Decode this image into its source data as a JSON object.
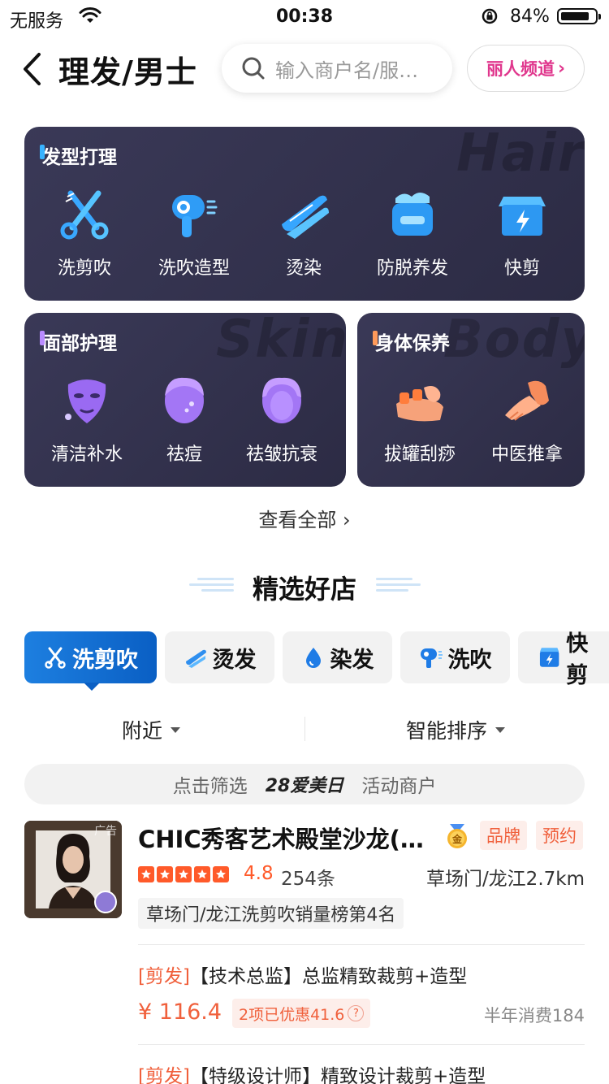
{
  "status_bar": {
    "carrier": "无服务",
    "time": "00:38",
    "battery": "84%"
  },
  "header": {
    "title": "理发/男士",
    "search_placeholder": "输入商户名/服务名",
    "channel_label": "丽人频道"
  },
  "categories": {
    "hair": {
      "title": "发型打理",
      "bg_word": "Hair",
      "items": [
        {
          "label": "洗剪吹",
          "icon": "scissors-icon"
        },
        {
          "label": "洗吹造型",
          "icon": "hair-dryer-icon"
        },
        {
          "label": "烫染",
          "icon": "hair-straightener-icon"
        },
        {
          "label": "防脱养发",
          "icon": "cream-jar-icon"
        },
        {
          "label": "快剪",
          "icon": "lightning-box-icon"
        }
      ]
    },
    "face": {
      "title": "面部护理",
      "bg_word": "Skin",
      "items": [
        {
          "label": "清洁补水",
          "icon": "face-mask-icon"
        },
        {
          "label": "祛痘",
          "icon": "face-acne-icon"
        },
        {
          "label": "祛皱抗衰",
          "icon": "face-wrinkle-icon"
        }
      ]
    },
    "body": {
      "title": "身体保养",
      "bg_word": "Body",
      "items": [
        {
          "label": "拔罐刮痧",
          "icon": "cupping-icon"
        },
        {
          "label": "中医推拿",
          "icon": "massage-hand-icon"
        }
      ]
    }
  },
  "view_all": "查看全部",
  "section_title": "精选好店",
  "chips": [
    {
      "label": "洗剪吹",
      "icon": "scissors-icon",
      "active": true
    },
    {
      "label": "烫发",
      "icon": "hair-straightener-icon",
      "active": false
    },
    {
      "label": "染发",
      "icon": "dye-drop-icon",
      "active": false
    },
    {
      "label": "洗吹",
      "icon": "hair-dryer-icon",
      "active": false
    },
    {
      "label": "快剪",
      "icon": "lightning-box-icon",
      "active": false
    }
  ],
  "filters": {
    "nearby": "附近",
    "sort": "智能排序"
  },
  "promo": {
    "left": "点击筛选",
    "brand": "28爱美日",
    "right": "活动商户"
  },
  "shop": {
    "ad_tag": "广告",
    "name": "CHIC秀客艺术殿堂沙龙(草场门店)",
    "tags": [
      "品牌",
      "预约"
    ],
    "rating": "4.8",
    "stars": 5,
    "reviews": "254条",
    "distance": "草场门/龙江2.7km",
    "rank": "草场门/龙江洗剪吹销量榜第4名",
    "deals": [
      {
        "category": "[剪发]",
        "title": "【技术总监】总监精致裁剪+造型",
        "price": "¥ 116.4",
        "discount": "2项已优惠41.6",
        "sales": "半年消费184"
      },
      {
        "category": "[剪发]",
        "title": "【特级设计师】精致设计裁剪+造型"
      }
    ]
  },
  "colors": {
    "accent_blue": "#0a5fc4",
    "accent_orange": "#f0603c",
    "channel_pink": "#e0378d",
    "panel_bg": "#33324c"
  }
}
